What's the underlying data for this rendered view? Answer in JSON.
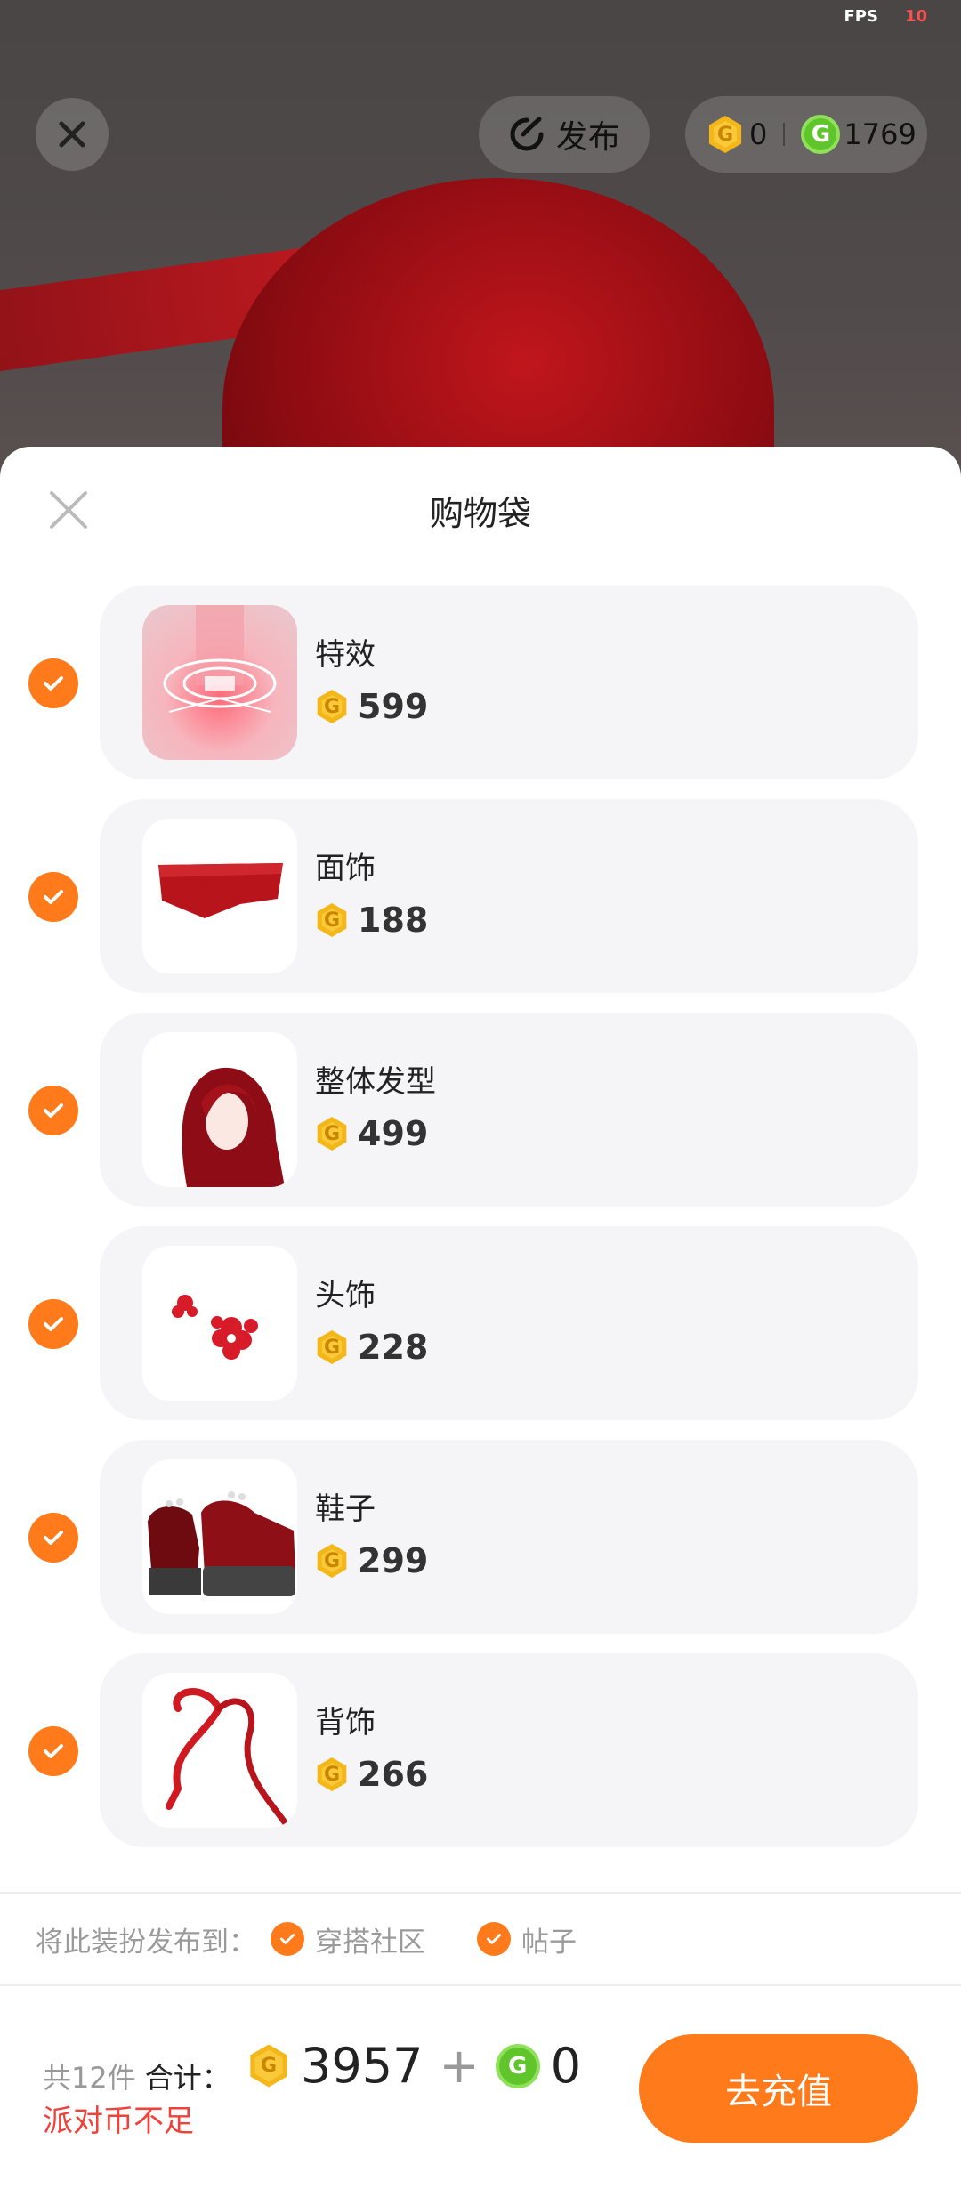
{
  "status": {
    "fps_label": "FPS",
    "fps_value": "10"
  },
  "top_bar": {
    "publish_label": "发布",
    "gold_balance": "0",
    "green_balance": "1769"
  },
  "sheet": {
    "title": "购物袋",
    "items": [
      {
        "name": "特效",
        "price": "599",
        "checked": true,
        "thumb": "effect"
      },
      {
        "name": "面饰",
        "price": "188",
        "checked": true,
        "thumb": "face-accessory"
      },
      {
        "name": "整体发型",
        "price": "499",
        "checked": true,
        "thumb": "hairstyle"
      },
      {
        "name": "头饰",
        "price": "228",
        "checked": true,
        "thumb": "headwear"
      },
      {
        "name": "鞋子",
        "price": "299",
        "checked": true,
        "thumb": "shoes"
      },
      {
        "name": "背饰",
        "price": "266",
        "checked": true,
        "thumb": "back-accessory"
      }
    ],
    "publish_to_label": "将此装扮发布到：",
    "publish_options": [
      {
        "label": "穿搭社区",
        "checked": true
      },
      {
        "label": "帖子",
        "checked": true
      }
    ]
  },
  "footer": {
    "count_label": "共12件",
    "total_label": "合计：",
    "gold_total": "3957",
    "plus": "+",
    "green_total": "0",
    "warning": "派对币不足",
    "recharge_label": "去充值"
  },
  "colors": {
    "accent": "#ff7a1a",
    "warning": "#f0423a",
    "gold_coin": "#f4b719",
    "green_coin": "#5fc52a"
  },
  "icons": [
    "close-icon",
    "publish-refresh-icon",
    "gold-coin-icon",
    "green-coin-icon",
    "check-icon"
  ]
}
